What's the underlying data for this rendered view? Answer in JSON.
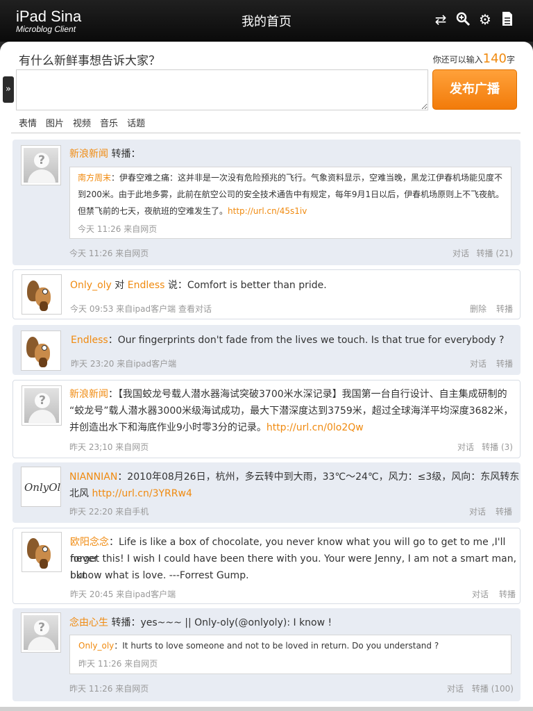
{
  "header": {
    "logo_main": "iPad Sina",
    "logo_sub": "Microblog Client",
    "title": "我的首页",
    "icons": [
      "swap-arrows-icon",
      "search-zoom-icon",
      "gear-icon",
      "document-icon"
    ]
  },
  "compose": {
    "question": "有什么新鲜事想告诉大家？",
    "counter_prefix": "你还可以输入",
    "counter_num": "140",
    "counter_suffix": "字",
    "placeholder": "",
    "publish": "发布广播",
    "tools": [
      "表情",
      "图片",
      "视频",
      "音乐",
      "话题"
    ]
  },
  "colors": {
    "accent": "#f08a0f",
    "card_blue": "#e8ecf3",
    "header_bg": "#111111"
  },
  "feed": [
    {
      "author": "新浪新闻",
      "verb": "转播：",
      "quote_author": "南方周末",
      "quote_line1": "：伊春空难之痛：这并非是一次没有危险预兆的飞行。气象资料显示，空难当晚，黑龙江伊春机场能见度不",
      "quote_line2": "到200米。由于此地多雾，此前在航空公司的安全技术通告中有规定，每年9月1日以后，伊春机场原则上不飞夜航。",
      "quote_line3": "但禁飞前的七天，夜航班的空难发生了。",
      "quote_url": "http://url.cn/45s1iv",
      "quote_meta": "今天  11:26  来自网页",
      "meta": "今天  11:26  来自网页",
      "action1": "对话",
      "action2": "转播 (21)"
    },
    {
      "author": "Only_oly",
      "mid": " 对 ",
      "target": "Endless",
      "text": " 说：Comfort is better than pride.",
      "meta": "今天  09:53  来自ipad客户端  查看对话",
      "action1": "删除",
      "action2": "转播"
    },
    {
      "author": "Endless",
      "text": "：Our fingerprints don't fade from the lives we touch.  Is that true for everybody ?",
      "meta": "昨天  23:20  来自ipad客户端",
      "action1": "对话",
      "action2": "转播"
    },
    {
      "author": "新浪新闻",
      "line1": "：【我国蛟龙号载人潜水器海试突破3700米水深记录】我国第一台自行设计、自主集成研制的",
      "line2": "“蛟龙号”载人潜水器3000米级海试成功，最大下潜深度达到3759米，超过全球海洋平均深度3682米，",
      "line3": "并创造出水下和海底作业9小时零3分的记录。",
      "url": "http://url.cn/0lo2Qw",
      "meta": "昨天  23;10  来自网页",
      "action1": "对话",
      "action2": "转播 (3)"
    },
    {
      "author": "NIANNIAN",
      "line1": "：2010年08月26日，杭州，多云转中到大雨，33℃～24℃，风力：≤3级，风向：东风转东",
      "line2": "北风 ",
      "url": "http://url.cn/3YRRw4",
      "meta": "昨天  22:20  来自手机",
      "action1": "对话",
      "action2": "转播",
      "avatar_sig": "OnlyOly"
    },
    {
      "author": "欧阳念念",
      "line1": "：Life is like a box of chocolate, you never know what you will go to get to me ,I'll never",
      "line2": "forget this! I wish I could have been there with you. Your were Jenny, I am not a smart man, but",
      "line3": "I know what is love. ---Forrest Gump.",
      "meta": "昨天  20:45 来自ipad客户端",
      "action1": "对话",
      "action2": "转播"
    },
    {
      "author": "念由心生",
      "verb": " 转播：yes~~~ || Only-oly(@onlyoly): I know !",
      "quote_author": "Only_oly",
      "quote_text": "：It hurts to love someone and not to be loved in return. Do you understand ?",
      "quote_meta": "昨天  11:26  来自网页",
      "meta": "昨天  11:26  来自网页",
      "action1": "对话",
      "action2": "转播 (100)"
    }
  ]
}
